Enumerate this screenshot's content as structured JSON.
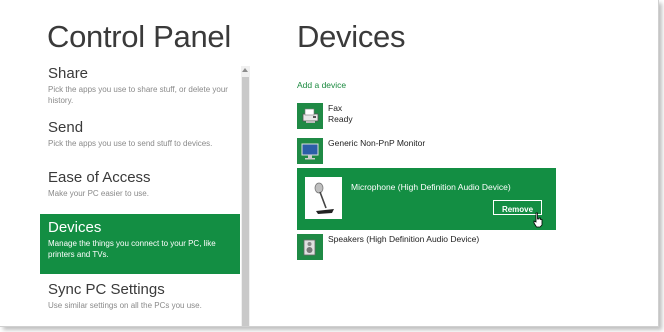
{
  "left_title": "Control Panel",
  "page_title": "Devices",
  "settings": [
    {
      "name": "Share",
      "desc": "Pick the apps you use to share stuff, or delete your history."
    },
    {
      "name": "Send",
      "desc": "Pick the apps you use to send stuff to devices."
    },
    {
      "name": "Ease of Access",
      "desc": "Make your PC easier to use."
    },
    {
      "name": "Devices",
      "desc": "Manage the things you connect to your PC, like printers and TVs."
    },
    {
      "name": "Sync PC Settings",
      "desc": "Use similar settings on all the PCs you use."
    }
  ],
  "add_device": "Add a device",
  "devices": [
    {
      "name": "Fax",
      "status": "Ready",
      "icon": "fax-icon"
    },
    {
      "name": "Generic Non-PnP Monitor",
      "status": "",
      "icon": "monitor-icon"
    },
    {
      "name": "Microphone (High Definition Audio Device)",
      "status": "",
      "icon": "microphone-icon"
    },
    {
      "name": "Speakers (High Definition Audio Device)",
      "status": "",
      "icon": "speaker-icon"
    }
  ],
  "remove_label": "Remove",
  "colors": {
    "accent": "#138e43",
    "link": "#1a8a3f"
  }
}
